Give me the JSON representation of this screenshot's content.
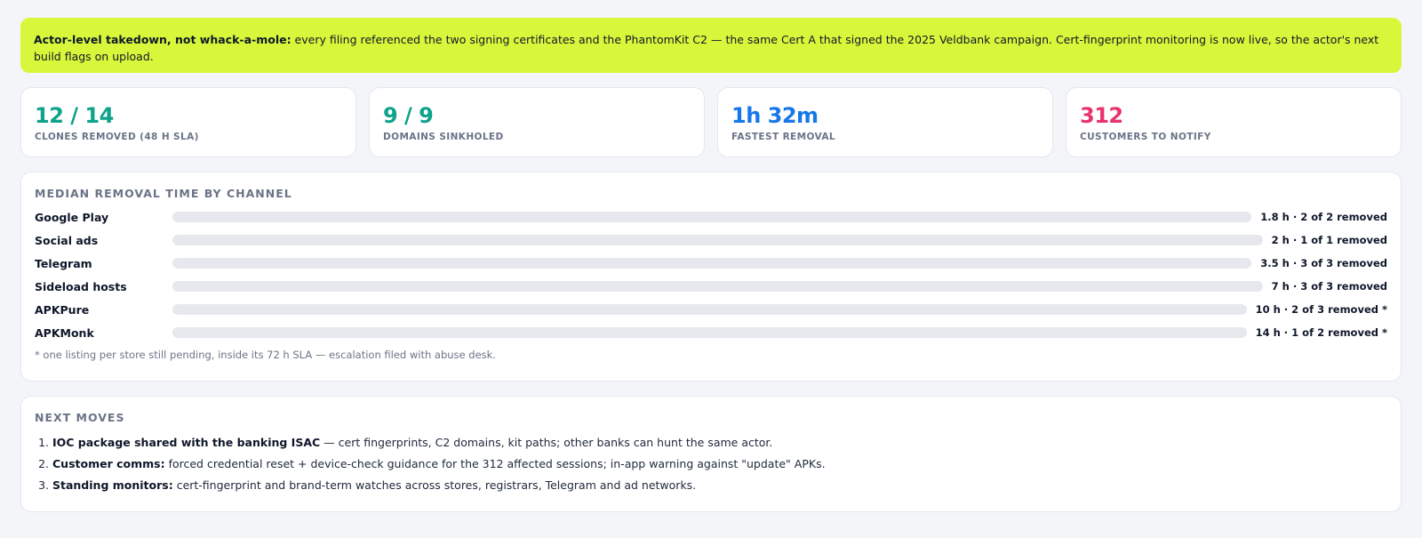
{
  "banner": {
    "lead": "Actor-level takedown, not whack-a-mole:",
    "text": " every filing referenced the two signing certificates and the PhantomKit C2 — the same Cert A that signed the 2025 Veldbank campaign. Cert-fingerprint monitoring is now live, so the actor's next build flags on upload.",
    "background": "#d9f73a"
  },
  "stats": [
    {
      "value": "12 / 14",
      "label": "CLONES REMOVED (48 H SLA)",
      "color": "#0ea38a"
    },
    {
      "value": "9 / 9",
      "label": "DOMAINS SINKHOLED",
      "color": "#0ea38a"
    },
    {
      "value": "1h 32m",
      "label": "FASTEST REMOVAL",
      "color": "#1677e8"
    },
    {
      "value": "312",
      "label": "CUSTOMERS TO NOTIFY",
      "color": "#e8336b"
    }
  ],
  "channels": {
    "title": "MEDIAN REMOVAL TIME BY CHANNEL",
    "rows": [
      {
        "name": "Google Play",
        "value": "1.8 h · 2 of 2 removed"
      },
      {
        "name": "Social ads",
        "value": "2 h · 1 of 1 removed"
      },
      {
        "name": "Telegram",
        "value": "3.5 h · 3 of 3 removed"
      },
      {
        "name": "Sideload hosts",
        "value": "7 h · 3 of 3 removed"
      },
      {
        "name": "APKPure",
        "value": "10 h · 2 of 3 removed *"
      },
      {
        "name": "APKMonk",
        "value": "14 h · 1 of 2 removed *"
      }
    ],
    "footnote": "* one listing per store still pending, inside its 72 h SLA — escalation filed with abuse desk."
  },
  "moves": {
    "title": "NEXT MOVES",
    "items": [
      {
        "lead": "IOC package shared with the banking ISAC",
        "text": " — cert fingerprints, C2 domains, kit paths; other banks can hunt the same actor."
      },
      {
        "lead": "Customer comms:",
        "text": " forced credential reset + device-check guidance for the 312 affected sessions; in-app warning against \"update\" APKs."
      },
      {
        "lead": "Standing monitors:",
        "text": " cert-fingerprint and brand-term watches across stores, registrars, Telegram and ad networks."
      }
    ]
  }
}
